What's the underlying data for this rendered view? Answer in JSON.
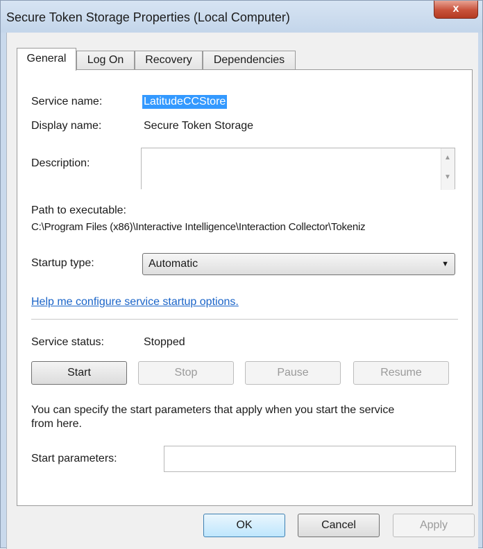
{
  "window": {
    "title": "Secure Token Storage Properties (Local Computer)",
    "close_icon": "x-icon",
    "close_label": "x"
  },
  "tabs": [
    {
      "label": "General",
      "active": true
    },
    {
      "label": "Log On",
      "active": false
    },
    {
      "label": "Recovery",
      "active": false
    },
    {
      "label": "Dependencies",
      "active": false
    }
  ],
  "general": {
    "service_name_label": "Service name:",
    "service_name_value": "LatitudeCCStore",
    "display_name_label": "Display name:",
    "display_name_value": "Secure Token Storage",
    "description_label": "Description:",
    "description_value": "",
    "path_label": "Path to executable:",
    "path_value": "C:\\Program Files (x86)\\Interactive Intelligence\\Interaction Collector\\Tokeniz",
    "startup_type_label": "Startup type:",
    "startup_type_value": "Automatic",
    "help_link": "Help me configure service startup options.",
    "service_status_label": "Service status:",
    "service_status_value": "Stopped",
    "buttons": {
      "start": "Start",
      "stop": "Stop",
      "pause": "Pause",
      "resume": "Resume"
    },
    "start_params_note": "You can specify the start parameters that apply when you start the service",
    "start_params_note_line2": "from here.",
    "start_params_label": "Start parameters:",
    "start_params_value": ""
  },
  "footer": {
    "ok": "OK",
    "cancel": "Cancel",
    "apply": "Apply"
  },
  "colors": {
    "selection": "#3399ff",
    "link": "#1a64c8",
    "close_button": "#c8513a"
  },
  "icons": {
    "dropdown": "chevron-down-icon",
    "scroll_up": "scroll-up-icon",
    "scroll_down": "scroll-down-icon"
  }
}
